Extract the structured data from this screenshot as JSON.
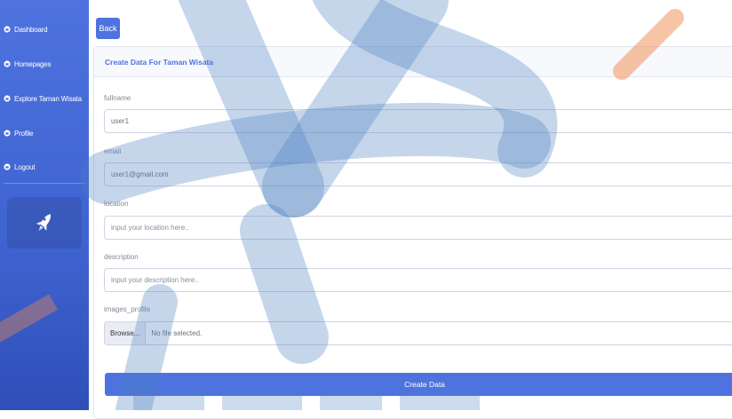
{
  "sidebar": {
    "items": [
      {
        "label": "Dashboard",
        "icon": "dashboard-icon"
      },
      {
        "label": "Homepages",
        "icon": "home-icon"
      },
      {
        "label": "Explore Taman Wisata",
        "icon": "explore-icon"
      },
      {
        "label": "Profile",
        "icon": "user-icon"
      },
      {
        "label": "Logout",
        "icon": "logout-icon"
      }
    ],
    "promo_icon": "rocket-icon"
  },
  "main": {
    "back_label": "Back",
    "card_title": "Create Data For Taman Wisata",
    "fields": {
      "fullname": {
        "label": "fullname",
        "value": "user1"
      },
      "email": {
        "label": "email",
        "value": "user1@gmail.com"
      },
      "location": {
        "label": "location",
        "placeholder": "input your location here.."
      },
      "description": {
        "label": "description",
        "placeholder": "input your description here.."
      },
      "images_profile": {
        "label": "images_profile",
        "browse_label": "Browse...",
        "file_status": "No file selected."
      }
    },
    "submit_label": "Create Data"
  },
  "colors": {
    "primary": "#4e73df",
    "sidebar_dark": "#2f4fb8",
    "watermark_blue": "#4a7fc1",
    "watermark_orange": "#f08a4b"
  }
}
